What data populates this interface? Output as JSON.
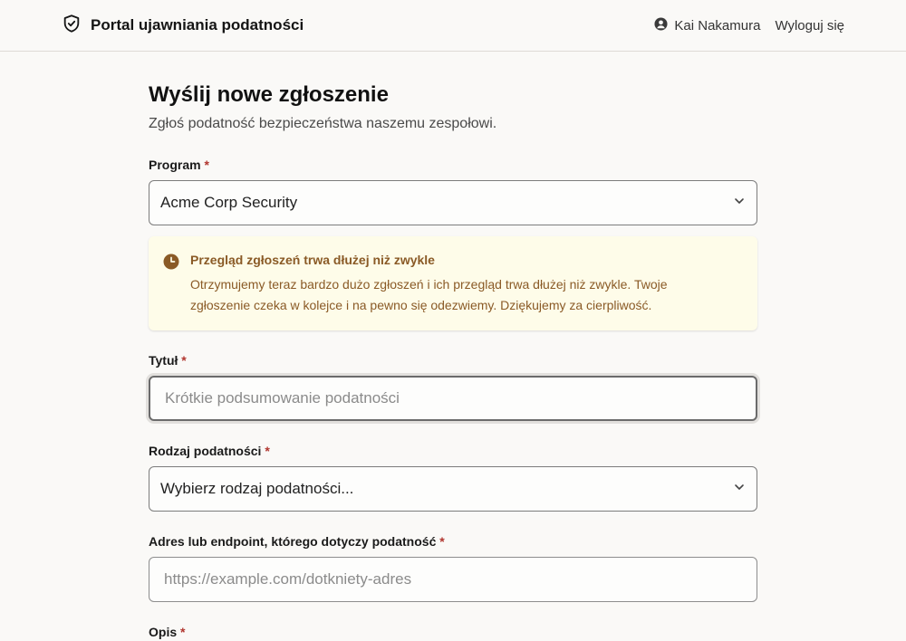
{
  "header": {
    "app_title": "Portal ujawniania podatności",
    "user_name": "Kai Nakamura",
    "logout_label": "Wyloguj się"
  },
  "page": {
    "title": "Wyślij nowe zgłoszenie",
    "subtitle": "Zgłoś podatność bezpieczeństwa naszemu zespołowi."
  },
  "form": {
    "program": {
      "label": "Program",
      "value": "Acme Corp Security"
    },
    "notice": {
      "title": "Przegląd zgłoszeń trwa dłużej niż zwykle",
      "line1": "Otrzymujemy teraz bardzo dużo zgłoszeń i ich przegląd trwa dłużej niż zwykle. Twoje",
      "line2": "zgłoszenie czeka w kolejce i na pewno się odezwiemy. Dziękujemy za cierpliwość."
    },
    "title_field": {
      "label": "Tytuł",
      "placeholder": "Krótkie podsumowanie podatności"
    },
    "vuln_type": {
      "label": "Rodzaj podatności",
      "value": "Wybierz rodzaj podatności..."
    },
    "endpoint": {
      "label": "Adres lub endpoint, którego dotyczy podatność",
      "placeholder": "https://example.com/dotkniety-adres"
    },
    "description": {
      "label": "Opis"
    },
    "required_marker": "*"
  },
  "colors": {
    "accent_required": "#b1362f",
    "notice_bg": "#fefce9",
    "notice_text": "#8a5a26"
  },
  "icons": {
    "brand": "shield-check-icon",
    "user": "user-circle-icon",
    "select": "chevron-down-icon",
    "notice": "clock-icon"
  }
}
